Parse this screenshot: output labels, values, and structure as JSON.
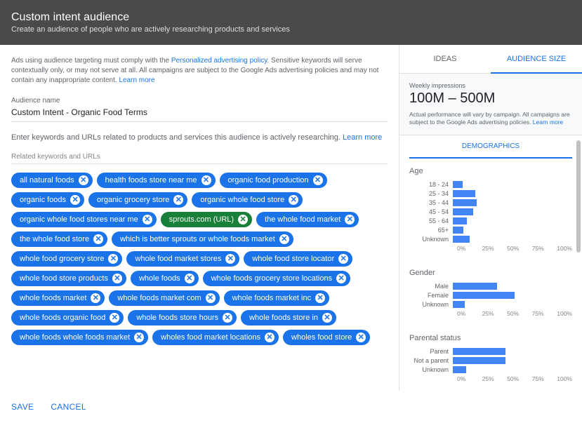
{
  "header": {
    "title": "Custom intent audience",
    "subtitle": "Create an audience of people who are actively researching products and services"
  },
  "notice": {
    "pre": "Ads using audience targeting must comply with the ",
    "link1": "Personalized advertising policy",
    "mid": ". Sensitive keywords will serve contextually only, or may not serve at all. All campaigns are subject to the Google Ads advertising policies and may not contain any inappropriate content. ",
    "link2": "Learn more"
  },
  "audience_name_label": "Audience name",
  "audience_name": "Custom Intent - Organic Food Terms",
  "instruct": {
    "text": "Enter keywords and URLs related to products and services this audience is actively researching. ",
    "link": "Learn more"
  },
  "section_label": "Related keywords and URLs",
  "chips": [
    {
      "label": "all natural foods",
      "type": "kw"
    },
    {
      "label": "health foods store near me",
      "type": "kw"
    },
    {
      "label": "organic food production",
      "type": "kw"
    },
    {
      "label": "organic foods",
      "type": "kw"
    },
    {
      "label": "organic grocery store",
      "type": "kw"
    },
    {
      "label": "organic whole food store",
      "type": "kw"
    },
    {
      "label": "organic whole food stores near me",
      "type": "kw"
    },
    {
      "label": "sprouts.com (URL)",
      "type": "url"
    },
    {
      "label": "the whole food market",
      "type": "kw"
    },
    {
      "label": "the whole food store",
      "type": "kw"
    },
    {
      "label": "which is better sprouts or whole foods market",
      "type": "kw"
    },
    {
      "label": "whole food grocery store",
      "type": "kw"
    },
    {
      "label": "whole food market stores",
      "type": "kw"
    },
    {
      "label": "whole food store locator",
      "type": "kw"
    },
    {
      "label": "whole food store products",
      "type": "kw"
    },
    {
      "label": "whole foods",
      "type": "kw"
    },
    {
      "label": "whole foods grocery store locations",
      "type": "kw"
    },
    {
      "label": "whole foods market",
      "type": "kw"
    },
    {
      "label": "whole foods market com",
      "type": "kw"
    },
    {
      "label": "whole foods market inc",
      "type": "kw"
    },
    {
      "label": "whole foods organic food",
      "type": "kw"
    },
    {
      "label": "whole foods store hours",
      "type": "kw"
    },
    {
      "label": "whole foods store in",
      "type": "kw"
    },
    {
      "label": "whole foods whole foods market",
      "type": "kw"
    },
    {
      "label": "wholes food market locations",
      "type": "kw"
    },
    {
      "label": "wholes food store",
      "type": "kw"
    }
  ],
  "tabs": {
    "ideas": "IDEAS",
    "audience_size": "AUDIENCE SIZE"
  },
  "impressions": {
    "label": "Weekly impressions",
    "value": "100M – 500M",
    "disclaimer_pre": "Actual performance will vary by campaign. All campaigns are subject to the Google Ads advertising policies. ",
    "disclaimer_link": "Learn more"
  },
  "demo_tab": "DEMOGRAPHICS",
  "axis_labels": [
    "0%",
    "25%",
    "50%",
    "75%",
    "100%"
  ],
  "chart_data": [
    {
      "type": "bar",
      "title": "Age",
      "categories": [
        "18 - 24",
        "25 - 34",
        "35 - 44",
        "45 - 54",
        "55 - 64",
        "65+",
        "Unknown"
      ],
      "values": [
        8,
        19,
        20,
        17,
        12,
        9,
        14
      ],
      "xlabel": "",
      "ylabel": "",
      "ylim": [
        0,
        100
      ]
    },
    {
      "type": "bar",
      "title": "Gender",
      "categories": [
        "Male",
        "Female",
        "Unknown"
      ],
      "values": [
        37,
        52,
        10
      ],
      "xlabel": "",
      "ylabel": "",
      "ylim": [
        0,
        100
      ]
    },
    {
      "type": "bar",
      "title": "Parental status",
      "categories": [
        "Parent",
        "Not a parent",
        "Unknown"
      ],
      "values": [
        44,
        44,
        11
      ],
      "xlabel": "",
      "ylabel": "",
      "ylim": [
        0,
        100
      ]
    }
  ],
  "footer": {
    "save": "SAVE",
    "cancel": "CANCEL"
  }
}
